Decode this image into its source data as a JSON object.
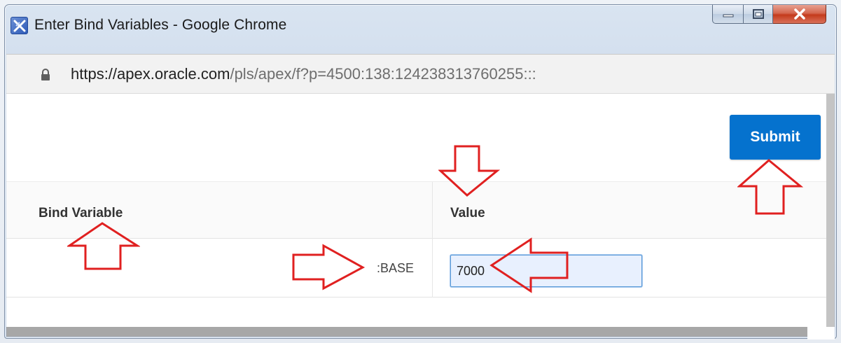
{
  "window": {
    "title": "Enter Bind Variables - Google Chrome",
    "controls": [
      "minimize",
      "maximize",
      "close"
    ]
  },
  "address_bar": {
    "host_part": "https://apex.oracle.com",
    "path_part": "/pls/apex/f?p=4500:138:124238313760255:::",
    "secure": true
  },
  "page": {
    "submit_label": "Submit",
    "columns": {
      "bind_variable": "Bind Variable",
      "value": "Value"
    },
    "rows": [
      {
        "variable": ":BASE",
        "value": "7000"
      }
    ]
  },
  "colors": {
    "accent": "#0572ce",
    "annotation_arrows": "#e02020"
  },
  "icons": [
    "app-icon",
    "lock-icon",
    "minimize-icon",
    "maximize-icon",
    "close-icon",
    "arrow-annotation"
  ]
}
